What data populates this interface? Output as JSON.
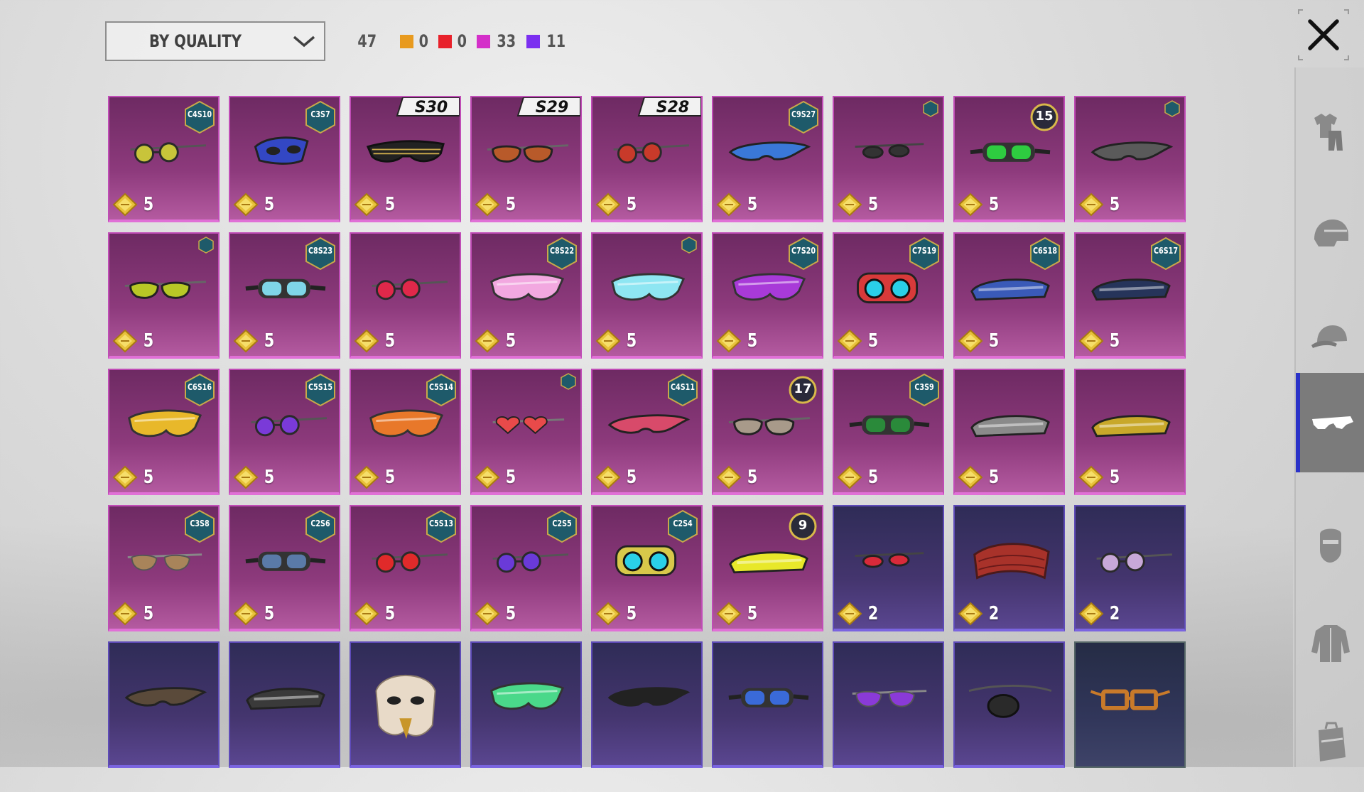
{
  "filter": {
    "sort_label": "BY QUALITY"
  },
  "summary": {
    "total": "47",
    "quality_counts": [
      {
        "color": "#e89a1e",
        "count": "0"
      },
      {
        "color": "#e8212b",
        "count": "0"
      },
      {
        "color": "#d42fc9",
        "count": "33"
      },
      {
        "color": "#7b2ff0",
        "count": "11"
      }
    ]
  },
  "rail": {
    "items": [
      {
        "icon": "outfit-icon",
        "active": false
      },
      {
        "icon": "helmet-icon",
        "active": false
      },
      {
        "icon": "cap-icon",
        "active": false
      },
      {
        "icon": "glasses-icon",
        "active": true
      },
      {
        "icon": "mask-icon",
        "active": false
      },
      {
        "icon": "jacket-icon",
        "active": false
      },
      {
        "icon": "backpack-icon",
        "active": false
      }
    ]
  },
  "items": [
    {
      "quality": "legendary",
      "tag": "C4S10",
      "tag_type": "hex",
      "price": "5",
      "icon": "round-sunglasses-icon",
      "color": "#c8c43a"
    },
    {
      "quality": "legendary",
      "tag": "C3S7",
      "tag_type": "hex",
      "price": "5",
      "icon": "masquerade-mask-icon",
      "color": "#3347c4"
    },
    {
      "quality": "legendary",
      "tag": "S30",
      "tag_type": "season",
      "price": "5",
      "icon": "shutter-shades-icon",
      "color": "#222222"
    },
    {
      "quality": "legendary",
      "tag": "S29",
      "tag_type": "season",
      "price": "5",
      "icon": "sport-sunglasses-icon",
      "color": "#b85a2a"
    },
    {
      "quality": "legendary",
      "tag": "S28",
      "tag_type": "season",
      "price": "5",
      "icon": "round-sunglasses-icon",
      "color": "#c83a2a"
    },
    {
      "quality": "legendary",
      "tag": "C9S27",
      "tag_type": "hex",
      "price": "5",
      "icon": "wrap-sunglasses-icon",
      "color": "#3a78d8"
    },
    {
      "quality": "legendary",
      "tag": "",
      "tag_type": "hex-small",
      "price": "5",
      "icon": "thin-glasses-icon",
      "color": "#333333"
    },
    {
      "quality": "legendary",
      "tag": "15",
      "tag_type": "level",
      "price": "5",
      "icon": "goggles-icon",
      "color": "#2ecc40"
    },
    {
      "quality": "legendary",
      "tag": "",
      "tag_type": "hex-small",
      "price": "5",
      "icon": "wrap-sunglasses-icon",
      "color": "#5a5a5a"
    },
    {
      "quality": "legendary",
      "tag": "",
      "tag_type": "hex-small",
      "price": "5",
      "icon": "sport-sunglasses-icon",
      "color": "#b8c826"
    },
    {
      "quality": "legendary",
      "tag": "C8S23",
      "tag_type": "hex",
      "price": "5",
      "icon": "goggles-icon",
      "color": "#7fd6e8"
    },
    {
      "quality": "legendary",
      "tag": "",
      "tag_type": "none",
      "price": "5",
      "icon": "round-sunglasses-icon",
      "color": "#e0284a"
    },
    {
      "quality": "legendary",
      "tag": "C8S22",
      "tag_type": "hex",
      "price": "5",
      "icon": "shield-sunglasses-icon",
      "color": "#f2a8e0"
    },
    {
      "quality": "legendary",
      "tag": "",
      "tag_type": "hex-small",
      "price": "5",
      "icon": "shield-sunglasses-icon",
      "color": "#8ee6f2"
    },
    {
      "quality": "legendary",
      "tag": "C7S20",
      "tag_type": "hex",
      "price": "5",
      "icon": "shield-sunglasses-icon",
      "color": "#a83ad8"
    },
    {
      "quality": "legendary",
      "tag": "C7S19",
      "tag_type": "hex",
      "price": "5",
      "icon": "tech-goggles-icon",
      "color": "#d83a3a"
    },
    {
      "quality": "legendary",
      "tag": "C6S18",
      "tag_type": "hex",
      "price": "5",
      "icon": "visor-icon",
      "color": "#3a5ab8"
    },
    {
      "quality": "legendary",
      "tag": "C6S17",
      "tag_type": "hex",
      "price": "5",
      "icon": "visor-icon",
      "color": "#26345a"
    },
    {
      "quality": "legendary",
      "tag": "C6S16",
      "tag_type": "hex",
      "price": "5",
      "icon": "shield-sunglasses-icon",
      "color": "#e8b82a"
    },
    {
      "quality": "legendary",
      "tag": "C5S15",
      "tag_type": "hex",
      "price": "5",
      "icon": "round-sunglasses-icon",
      "color": "#7a3ad8"
    },
    {
      "quality": "legendary",
      "tag": "C5S14",
      "tag_type": "hex",
      "price": "5",
      "icon": "shield-sunglasses-icon",
      "color": "#e8782a"
    },
    {
      "quality": "legendary",
      "tag": "",
      "tag_type": "hex-small",
      "price": "5",
      "icon": "heart-sunglasses-icon",
      "color": "#e84a4a"
    },
    {
      "quality": "legendary",
      "tag": "C4S11",
      "tag_type": "hex",
      "price": "5",
      "icon": "wrap-sunglasses-icon",
      "color": "#d84a6a"
    },
    {
      "quality": "legendary",
      "tag": "17",
      "tag_type": "level",
      "price": "5",
      "icon": "sport-sunglasses-icon",
      "color": "#a89a8a"
    },
    {
      "quality": "legendary",
      "tag": "C3S9",
      "tag_type": "hex",
      "price": "5",
      "icon": "goggles-icon",
      "color": "#2a8a3a"
    },
    {
      "quality": "legendary",
      "tag": "",
      "tag_type": "none",
      "price": "5",
      "icon": "visor-icon",
      "color": "#8a8a8a"
    },
    {
      "quality": "legendary",
      "tag": "",
      "tag_type": "none",
      "price": "5",
      "icon": "visor-icon",
      "color": "#c8a82a"
    },
    {
      "quality": "legendary",
      "tag": "C3S8",
      "tag_type": "hex",
      "price": "5",
      "icon": "aviator-sunglasses-icon",
      "color": "#a8845a"
    },
    {
      "quality": "legendary",
      "tag": "C2S6",
      "tag_type": "hex",
      "price": "5",
      "icon": "goggles-icon",
      "color": "#5a7aa8"
    },
    {
      "quality": "legendary",
      "tag": "C5S13",
      "tag_type": "hex",
      "price": "5",
      "icon": "round-sunglasses-icon",
      "color": "#e02a2a"
    },
    {
      "quality": "legendary",
      "tag": "C2S5",
      "tag_type": "hex",
      "price": "5",
      "icon": "round-sunglasses-icon",
      "color": "#6a3ad8"
    },
    {
      "quality": "legendary",
      "tag": "C2S4",
      "tag_type": "hex",
      "price": "5",
      "icon": "tech-goggles-icon",
      "color": "#d8c84a"
    },
    {
      "quality": "legendary",
      "tag": "9",
      "tag_type": "level",
      "price": "5",
      "icon": "visor-icon",
      "color": "#e8e82a"
    },
    {
      "quality": "epic",
      "tag": "",
      "tag_type": "none",
      "price": "2",
      "icon": "thin-glasses-icon",
      "color": "#d82a3a"
    },
    {
      "quality": "epic",
      "tag": "",
      "tag_type": "none",
      "price": "2",
      "icon": "headband-icon",
      "color": "#a8322a"
    },
    {
      "quality": "epic",
      "tag": "",
      "tag_type": "none",
      "price": "2",
      "icon": "round-sunglasses-icon",
      "color": "#c8a8d8"
    },
    {
      "quality": "epic",
      "tag": "",
      "tag_type": "none",
      "price": "",
      "icon": "wrap-sunglasses-icon",
      "color": "#5a4a3a"
    },
    {
      "quality": "epic",
      "tag": "",
      "tag_type": "none",
      "price": "",
      "icon": "visor-icon",
      "color": "#3a3a3a"
    },
    {
      "quality": "epic",
      "tag": "",
      "tag_type": "none",
      "price": "",
      "icon": "eagle-mask-icon",
      "color": "#e8dac8"
    },
    {
      "quality": "epic",
      "tag": "",
      "tag_type": "none",
      "price": "",
      "icon": "shield-sunglasses-icon",
      "color": "#4ad88a"
    },
    {
      "quality": "epic",
      "tag": "",
      "tag_type": "none",
      "price": "",
      "icon": "wrap-sunglasses-icon",
      "color": "#222222"
    },
    {
      "quality": "epic",
      "tag": "",
      "tag_type": "none",
      "price": "",
      "icon": "goggles-icon",
      "color": "#3a6ad8"
    },
    {
      "quality": "epic",
      "tag": "",
      "tag_type": "none",
      "price": "",
      "icon": "aviator-sunglasses-icon",
      "color": "#8a3ad8"
    },
    {
      "quality": "epic",
      "tag": "",
      "tag_type": "none",
      "price": "",
      "icon": "eyepatch-icon",
      "color": "#2a2a2a"
    },
    {
      "quality": "epic2",
      "tag": "",
      "tag_type": "none",
      "price": "",
      "icon": "square-glasses-icon",
      "color": "#c87a2a"
    }
  ]
}
